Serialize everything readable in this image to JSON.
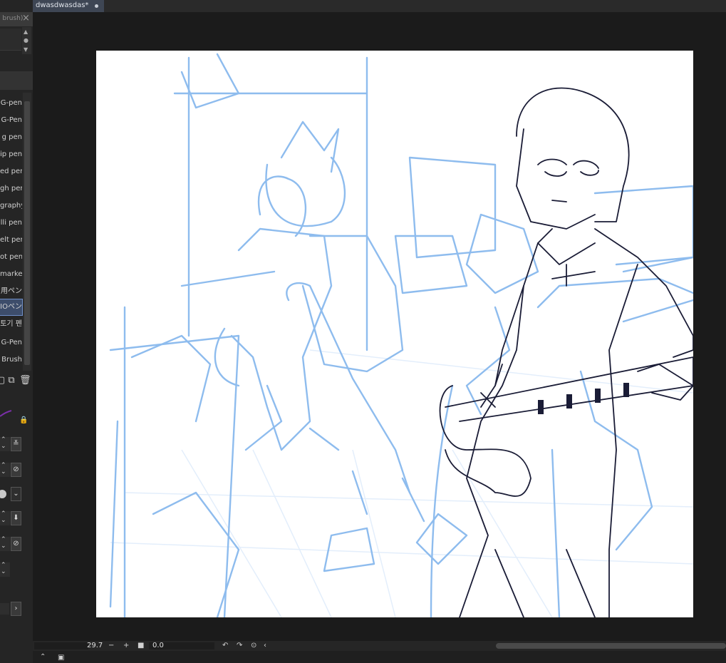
{
  "document": {
    "tab_title": "dwasdwasdas*"
  },
  "subtool_panel": {
    "title": "l brush)"
  },
  "brush_list": {
    "items": [
      {
        "label": "G-pen",
        "selected": false
      },
      {
        "label": "G-Pen",
        "selected": false
      },
      {
        "label": "g pen",
        "selected": false
      },
      {
        "label": "ip pen",
        "selected": false
      },
      {
        "label": "ed pen",
        "selected": false
      },
      {
        "label": "gh pen",
        "selected": false
      },
      {
        "label": "graphy",
        "selected": false
      },
      {
        "label": "lli pen",
        "selected": false
      },
      {
        "label": "elt pen",
        "selected": false
      },
      {
        "label": "ot pen",
        "selected": false
      },
      {
        "label": "marker",
        "selected": false
      },
      {
        "label": "用ペン",
        "selected": false
      },
      {
        "label": "IOペン",
        "selected": true
      },
      {
        "label": "토기 펜",
        "selected": false
      },
      {
        "label": "G-Pen",
        "selected": false
      },
      {
        "label": "Brush",
        "selected": false
      }
    ]
  },
  "navigator": {
    "zoom": "29.7",
    "rotation": "0.0"
  },
  "colors": {
    "sketch_blue": "#7fb2ea",
    "ink": "#1a1c36",
    "selection": "#3d4d6b"
  }
}
